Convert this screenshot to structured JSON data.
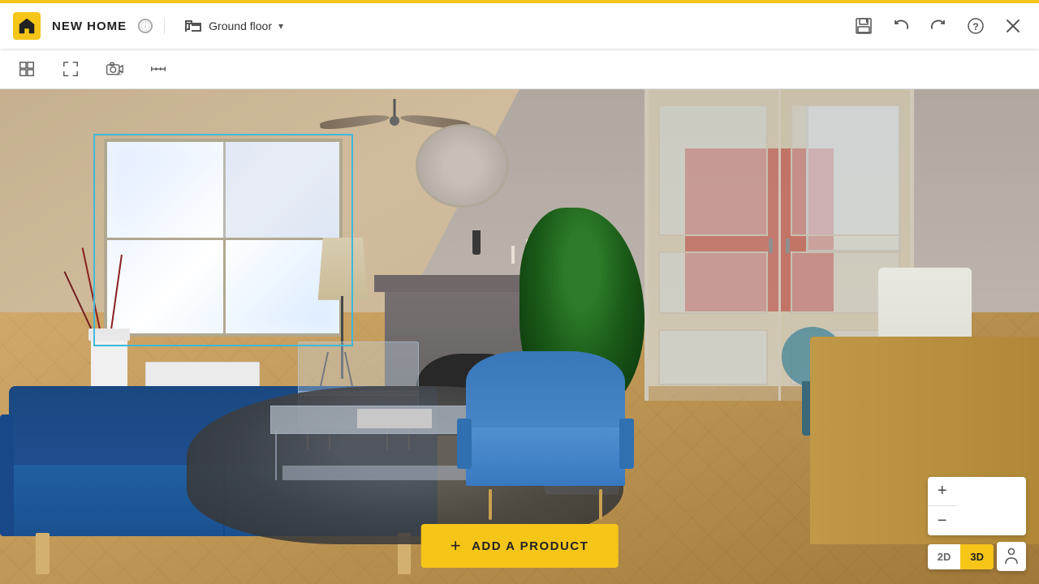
{
  "app": {
    "title": "NEW HOME",
    "info_icon": "ⓘ",
    "floor": {
      "icon": "floor-plan-icon",
      "label": "Ground floor",
      "chevron": "▾"
    }
  },
  "header": {
    "save_icon": "💾",
    "undo_icon": "↩",
    "redo_icon": "↪",
    "help_icon": "?",
    "close_icon": "✕"
  },
  "toolbar": {
    "grid_icon": "grid",
    "fullscreen_icon": "fullscreen",
    "camera3d_icon": "camera3d",
    "measure_icon": "measure"
  },
  "viewport": {
    "scene_type": "3D living room"
  },
  "add_product_button": {
    "label": "ADD A PRODUCT",
    "plus": "+"
  },
  "view_controls": {
    "zoom_in": "+",
    "zoom_out": "−",
    "mode_2d": "2D",
    "mode_3d": "3D",
    "person_icon": "🚶"
  },
  "colors": {
    "accent_yellow": "#f5c518",
    "sofa_blue": "#1a5090",
    "armchair_blue": "#3878c0",
    "wall_back": "#b8b0a8",
    "floor_wood": "#c8a060",
    "rug_dark": "#484848"
  }
}
